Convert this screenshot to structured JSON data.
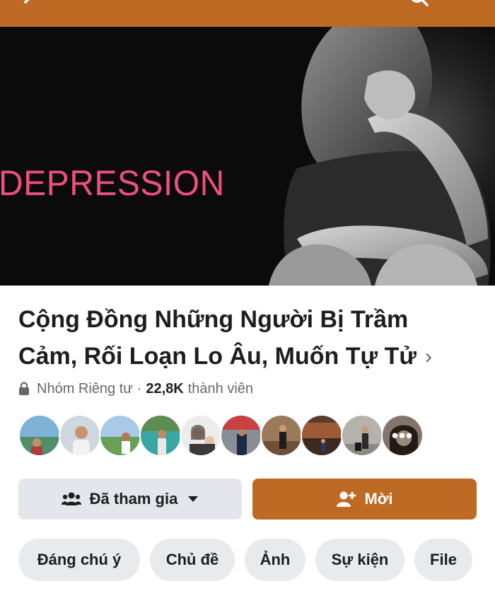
{
  "colors": {
    "accent": "#bf6a24",
    "cover_text": "#ee4f7e",
    "chip_bg": "#e9eaee",
    "secondary_btn_bg": "#e4e6eb"
  },
  "header": {
    "back_icon": "chevron-left-icon",
    "search_icon": "search-icon"
  },
  "cover": {
    "text": "DEPRESSION"
  },
  "group": {
    "title": "Cộng Đồng Những Người Bị Trầm Cảm, Rối Loạn Lo Âu, Muốn Tự Tử",
    "privacy": "Nhóm Riêng tư",
    "separator": "·",
    "member_count": "22,8K",
    "member_label": "thành viên"
  },
  "avatars": {
    "more_label": "•••"
  },
  "actions": {
    "joined_label": "Đã tham gia",
    "invite_label": "Mời"
  },
  "tabs": [
    "Đáng chú ý",
    "Chủ đề",
    "Ảnh",
    "Sự kiện",
    "File"
  ]
}
